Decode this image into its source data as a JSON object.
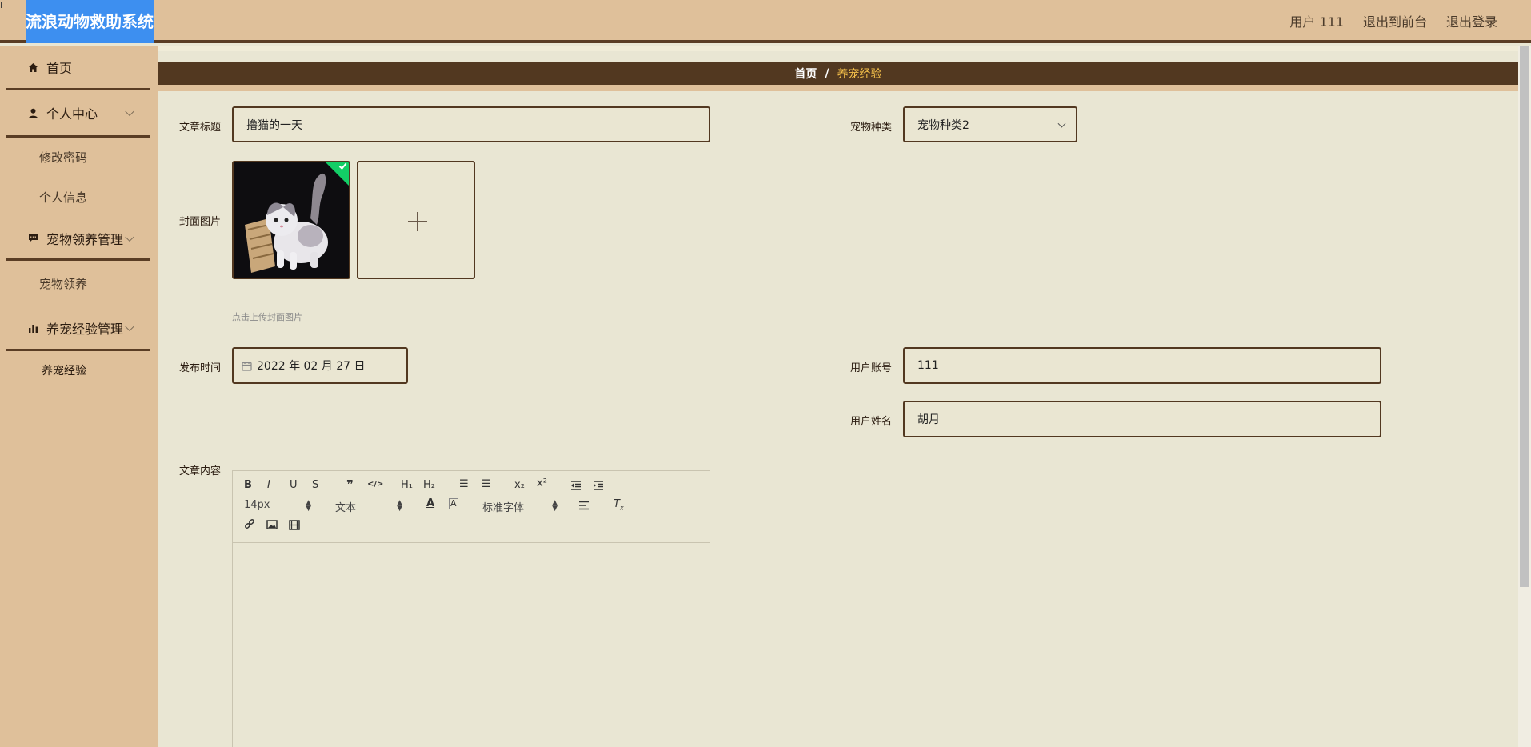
{
  "app": {
    "title": "流浪动物救助系统",
    "corner_mark": "I"
  },
  "header": {
    "user_label": "用户 111",
    "back_to_front": "退出到前台",
    "logout": "退出登录"
  },
  "sidebar": {
    "home": "首页",
    "personal_center": "个人中心",
    "change_password": "修改密码",
    "personal_info": "个人信息",
    "pet_adopt_mgmt": "宠物领养管理",
    "pet_adopt": "宠物领养",
    "pet_exp_mgmt": "养宠经验管理",
    "pet_exp": "养宠经验"
  },
  "breadcrumb": {
    "home": "首页",
    "separator": "/",
    "current": "养宠经验"
  },
  "form": {
    "title_label": "文章标题",
    "title_value": "撸猫的一天",
    "pet_type_label": "宠物种类",
    "pet_type_value": "宠物种类2",
    "cover_label": "封面图片",
    "cover_hint": "点击上传封面图片",
    "publish_label": "发布时间",
    "publish_value": "2022 年 02 月 27 日",
    "account_label": "用户账号",
    "account_value": "111",
    "name_label": "用户姓名",
    "name_value": "胡月",
    "content_label": "文章内容"
  },
  "editor": {
    "font_size": "14px",
    "header_select": "文本",
    "font_family": "标准字体",
    "buttons": [
      "B",
      "I",
      "U",
      "S",
      "❞",
      "</>",
      "H₁",
      "H₂",
      "☰",
      "☰",
      "x₂",
      "x²"
    ]
  },
  "colors": {
    "header_bg": "#dfc09a",
    "breadcrumb_bg": "#523820",
    "accent": "#f5c04a",
    "page_bg": "#e9e6d3",
    "logo_bg": "#3d8ff0"
  }
}
